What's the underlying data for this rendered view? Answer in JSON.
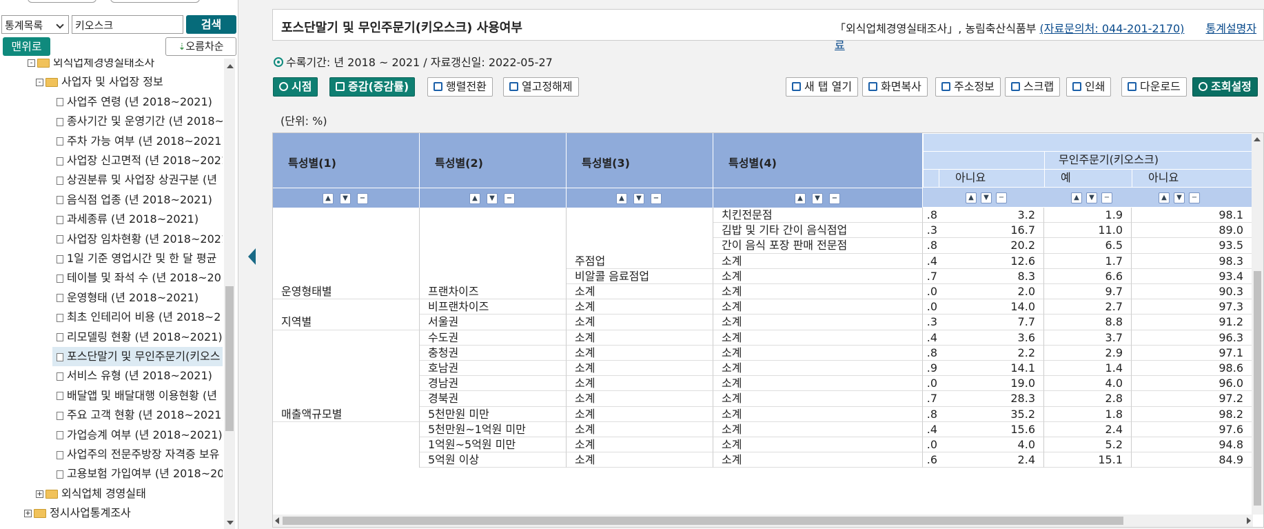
{
  "sidebar": {
    "category_select": "통계목록",
    "search_value": "키오스크",
    "search_button": "검색",
    "top_button": "맨위로",
    "sort_button": "오름차순",
    "tree": [
      {
        "label": "외식업체경영실태조사",
        "type": "folder",
        "expander": "-"
      },
      {
        "label": "사업자 및 사업장 정보",
        "type": "folder",
        "expander": "-"
      },
      {
        "label": "사업주 연령 (년 2018~2021)",
        "type": "doc"
      },
      {
        "label": "종사기간 및 운영기간 (년 2018~",
        "type": "doc"
      },
      {
        "label": "주차 가능 여부 (년 2018~2021)",
        "type": "doc"
      },
      {
        "label": "사업장 신고면적 (년 2018~2021",
        "type": "doc"
      },
      {
        "label": "상권분류 및 사업장 상권구분 (년",
        "type": "doc"
      },
      {
        "label": "음식점 업종 (년 2018~2021)",
        "type": "doc"
      },
      {
        "label": "과세종류 (년 2018~2021)",
        "type": "doc"
      },
      {
        "label": "사업장 임차현황 (년 2018~2021",
        "type": "doc"
      },
      {
        "label": "1일 기준 영업시간 및 한 달 평균",
        "type": "doc"
      },
      {
        "label": "테이블 및 좌석 수 (년 2018~20",
        "type": "doc"
      },
      {
        "label": "운영형태 (년 2018~2021)",
        "type": "doc"
      },
      {
        "label": "최초 인테리어 비용 (년 2018~2",
        "type": "doc"
      },
      {
        "label": "리모델링 현황 (년 2018~2021)",
        "type": "doc"
      },
      {
        "label": "포스단말기 및 무인주문기(키오스",
        "type": "doc",
        "selected": true
      },
      {
        "label": "서비스 유형 (년 2018~2021)",
        "type": "doc"
      },
      {
        "label": "배달앱 및 배달대행 이용현황 (년",
        "type": "doc"
      },
      {
        "label": "주요 고객 현황 (년 2018~2021)",
        "type": "doc"
      },
      {
        "label": "가업승계 여부 (년 2018~2021)",
        "type": "doc"
      },
      {
        "label": "사업주의 전문주방장 자격증 보유",
        "type": "doc"
      },
      {
        "label": "고용보험 가입여부 (년 2018~20",
        "type": "doc"
      },
      {
        "label": "외식업체 경영실태",
        "type": "folder",
        "expander": "+"
      },
      {
        "label": "정시사업통계조사",
        "type": "folder",
        "expander": "+"
      }
    ]
  },
  "header": {
    "title": "포스단말기 및 무인주문기(키오스크) 사용여부",
    "source": "「외식업체경영실태조사」, 농림축산식품부",
    "contact_link": "(자료문의처: 044-201-2170)",
    "guide_link": "통계설명자료"
  },
  "period": {
    "text": "수록기간: 년 2018 ~ 2021 / 자료갱신일: 2022-05-27"
  },
  "toolbar": {
    "time": "시점",
    "rate": "증감(증감률)",
    "pivot": "행렬전환",
    "unfix": "열고정해제",
    "newtab": "새 탭 열기",
    "copy": "화면복사",
    "address": "주소정보",
    "scrap": "스크랩",
    "print": "인쇄",
    "download": "다운로드",
    "settings": "조회설정"
  },
  "table": {
    "unit": "(단위: %)",
    "header_cols": [
      "특성별(1)",
      "특성별(2)",
      "특성별(3)",
      "특성별(4)"
    ],
    "group_header": "무인주문기(키오스크)",
    "value_headers": [
      "아니요",
      "예",
      "아니요"
    ],
    "rows": [
      {
        "c1": "",
        "c2": "",
        "c3": "",
        "c4": "치킨전문점",
        "cut": ".8",
        "v1": "3.2",
        "v2": "1.9",
        "v3": "98.1"
      },
      {
        "c1": "",
        "c2": "",
        "c3": "",
        "c4": "김밥 및 기타 간이 음식점업",
        "cut": ".3",
        "v1": "16.7",
        "v2": "11.0",
        "v3": "89.0"
      },
      {
        "c1": "",
        "c2": "",
        "c3": "",
        "c4": "간이 음식 포장 판매 전문점",
        "cut": ".8",
        "v1": "20.2",
        "v2": "6.5",
        "v3": "93.5"
      },
      {
        "c1": "",
        "c2": "",
        "c3": "주점업",
        "c4": "소계",
        "cut": ".4",
        "v1": "12.6",
        "v2": "1.7",
        "v3": "98.3"
      },
      {
        "c1": "",
        "c2": "",
        "c3": "비알콜 음료점업",
        "c4": "소계",
        "cut": ".7",
        "v1": "8.3",
        "v2": "6.6",
        "v3": "93.4"
      },
      {
        "c1": "운영형태별",
        "c2": "프랜차이즈",
        "c3": "소계",
        "c4": "소계",
        "cut": ".0",
        "v1": "2.0",
        "v2": "9.7",
        "v3": "90.3"
      },
      {
        "c1": "",
        "c2": "비프랜차이즈",
        "c3": "소계",
        "c4": "소계",
        "cut": ".0",
        "v1": "14.0",
        "v2": "2.7",
        "v3": "97.3"
      },
      {
        "c1": "지역별",
        "c2": "서울권",
        "c3": "소계",
        "c4": "소계",
        "cut": ".3",
        "v1": "7.7",
        "v2": "8.8",
        "v3": "91.2"
      },
      {
        "c1": "",
        "c2": "수도권",
        "c3": "소계",
        "c4": "소계",
        "cut": ".4",
        "v1": "3.6",
        "v2": "3.7",
        "v3": "96.3"
      },
      {
        "c1": "",
        "c2": "충청권",
        "c3": "소계",
        "c4": "소계",
        "cut": ".8",
        "v1": "2.2",
        "v2": "2.9",
        "v3": "97.1"
      },
      {
        "c1": "",
        "c2": "호남권",
        "c3": "소계",
        "c4": "소계",
        "cut": ".9",
        "v1": "14.1",
        "v2": "1.4",
        "v3": "98.6"
      },
      {
        "c1": "",
        "c2": "경남권",
        "c3": "소계",
        "c4": "소계",
        "cut": ".0",
        "v1": "19.0",
        "v2": "4.0",
        "v3": "96.0"
      },
      {
        "c1": "",
        "c2": "경북권",
        "c3": "소계",
        "c4": "소계",
        "cut": ".7",
        "v1": "28.3",
        "v2": "2.8",
        "v3": "97.2"
      },
      {
        "c1": "매출액규모별",
        "c2": "5천만원 미만",
        "c3": "소계",
        "c4": "소계",
        "cut": ".8",
        "v1": "35.2",
        "v2": "1.8",
        "v3": "98.2"
      },
      {
        "c1": "",
        "c2": "5천만원~1억원 미만",
        "c3": "소계",
        "c4": "소계",
        "cut": ".4",
        "v1": "15.6",
        "v2": "2.4",
        "v3": "97.6"
      },
      {
        "c1": "",
        "c2": "1억원~5억원 미만",
        "c3": "소계",
        "c4": "소계",
        "cut": ".0",
        "v1": "4.0",
        "v2": "5.2",
        "v3": "94.8"
      },
      {
        "c1": "",
        "c2": "5억원 이상",
        "c3": "소계",
        "c4": "소계",
        "cut": ".6",
        "v1": "2.4",
        "v2": "15.1",
        "v3": "84.9"
      }
    ]
  }
}
